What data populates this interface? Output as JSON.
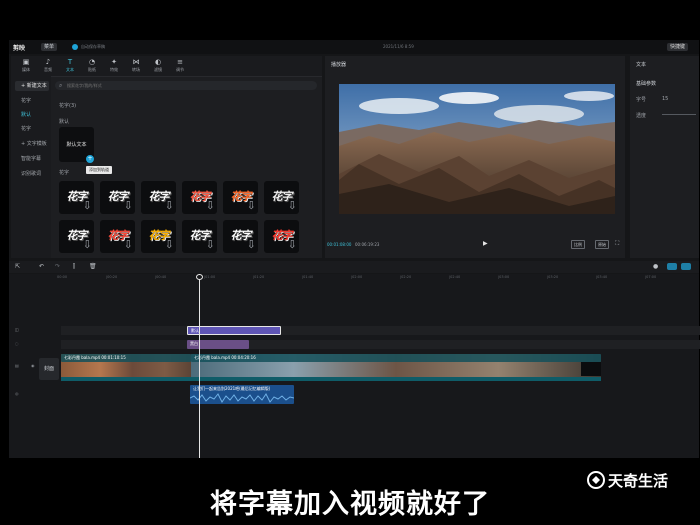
{
  "titlebar": {
    "brand": "剪映",
    "menu_label": "菜单",
    "save_status": "自动保存草稿",
    "project_title": "2021/11/6 8:59",
    "shortcut_label": "快捷键"
  },
  "toolbar": {
    "tools": [
      {
        "icon": "media-icon",
        "glyph": "▣",
        "label": "媒体"
      },
      {
        "icon": "audio-icon",
        "glyph": "♪",
        "label": "音频"
      },
      {
        "icon": "text-icon",
        "glyph": "T",
        "label": "文本"
      },
      {
        "icon": "sticker-icon",
        "glyph": "◔",
        "label": "贴纸"
      },
      {
        "icon": "effects-icon",
        "glyph": "✦",
        "label": "特效"
      },
      {
        "icon": "transition-icon",
        "glyph": "⋈",
        "label": "转场"
      },
      {
        "icon": "filter-icon",
        "glyph": "◐",
        "label": "滤镜"
      },
      {
        "icon": "adjust-icon",
        "glyph": "≡",
        "label": "调节"
      }
    ],
    "active_index": 2
  },
  "sidenav": {
    "items": [
      "+ 新建文本",
      "花字",
      "默认",
      "花字",
      "+ 文字模板",
      "智能字幕",
      "识别歌词"
    ]
  },
  "text_panel": {
    "search_placeholder": "搜索花字/我的/样式",
    "section_label": "花字(3)",
    "default_label": "默认",
    "default_tile_text": "默认文本",
    "tooltip": "添加到轨道",
    "flower_label": "花字",
    "flower_text": "花字",
    "flower_colors": [
      "#ffffff",
      "#ffffff",
      "#ffffff",
      "#ff5a44",
      "#ff6a2a",
      "#f2f2f2",
      "#ffffff",
      "#ff4a3a",
      "#ffb400",
      "#ffffff",
      "#ffffff",
      "#ff3b30"
    ]
  },
  "preview": {
    "title": "播放器",
    "current_time": "00:01:08:00",
    "total_time": "00:06:19:23",
    "ratio_label": "比例",
    "original_label": "原始"
  },
  "props": {
    "title": "文本",
    "subtitle": "基础参数",
    "rows": [
      {
        "label": "字号",
        "value": "15"
      },
      {
        "label": "透度",
        "value": ""
      }
    ]
  },
  "timeline": {
    "ticks": [
      "00:00",
      "|00:20",
      "|00:40",
      "|01:00",
      "|01:20",
      "|01:40",
      "|02:00",
      "|02:20",
      "|02:40",
      "|03:00",
      "|03:20",
      "|03:40",
      "|07:00"
    ],
    "cover_label": "封面",
    "text_clip": "默认",
    "effect_clip": "黑白",
    "video_clip_1": "七彩丹霞 bala.mp4  00:01:10:15",
    "video_clip_2": "七彩丹霞 bala.mp4  00:04:20:16",
    "audio_clip": "让我们一起来告别2021吧(最后记忆编辑版)"
  },
  "overlay": {
    "subtitle": "将字幕加入视频就好了",
    "watermark": "天奇生活"
  }
}
